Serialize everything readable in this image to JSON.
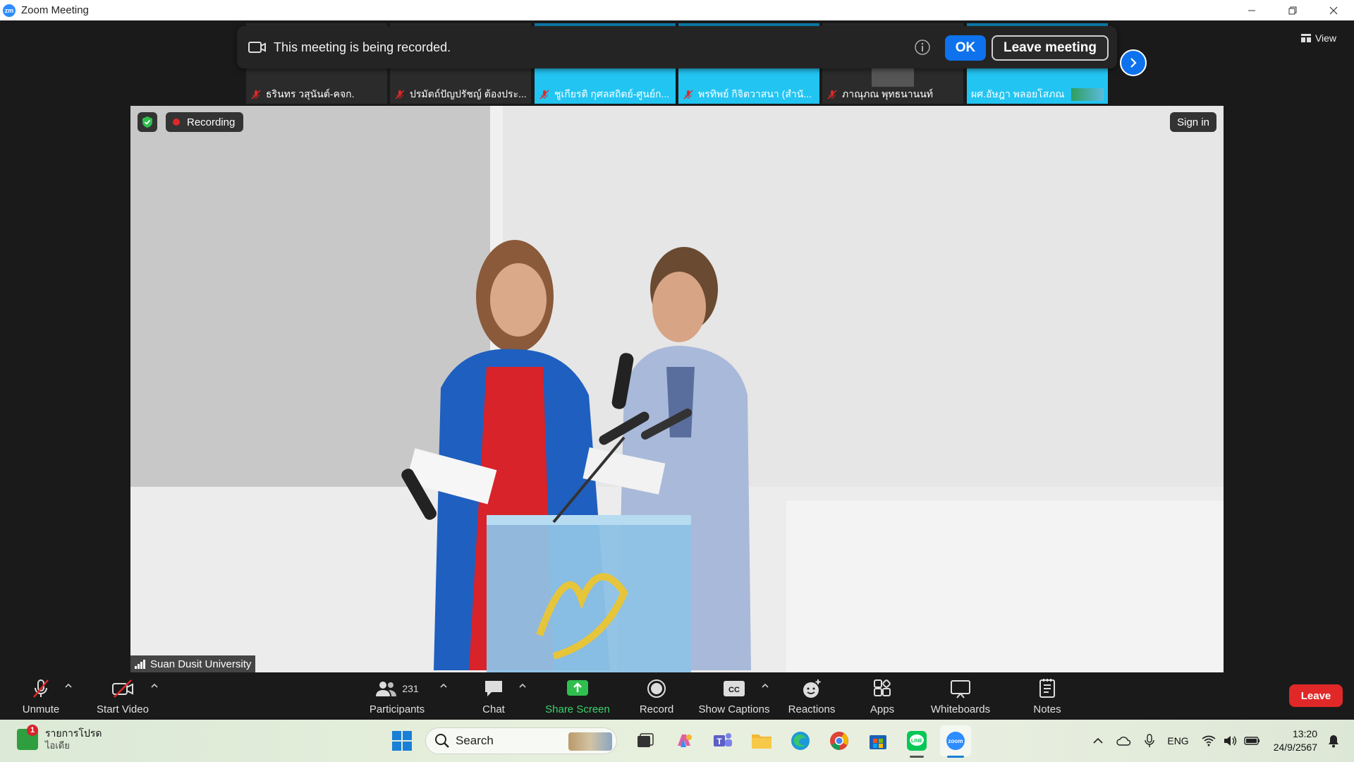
{
  "window": {
    "title": "Zoom Meeting",
    "app_icon": "zm"
  },
  "banner": {
    "message": "This meeting is being recorded.",
    "ok_label": "OK",
    "leave_label": "Leave meeting"
  },
  "view_label": "View",
  "gallery": [
    {
      "name": "ธรินทร วสุนันต์-คจก.",
      "bg": "dark"
    },
    {
      "name": "ปรมัตถ์ปัญปรัชญ์ ต้องประ...",
      "bg": "dark"
    },
    {
      "name": "ชูเกียรติ กุศลสถิตย์-ศูนย์ก...",
      "bg": "blue"
    },
    {
      "name": "พรทิพย์ กิจิตวาสนา (สำนั...",
      "bg": "blue"
    },
    {
      "name": "ภาณุภณ พุทธนานนท์",
      "bg": "dark"
    },
    {
      "name": "ผศ.อัษฎา พลอยโสภณ",
      "bg": "blue"
    }
  ],
  "video": {
    "recording_label": "Recording",
    "signin_label": "Sign in",
    "speaker_name": "Suan Dusit University",
    "podium_logo": "สดุ"
  },
  "toolbar": {
    "unmute": "Unmute",
    "start_video": "Start Video",
    "participants": "Participants",
    "participants_count": "231",
    "chat": "Chat",
    "share_screen": "Share Screen",
    "record": "Record",
    "captions": "Show Captions",
    "reactions": "Reactions",
    "apps": "Apps",
    "whiteboards": "Whiteboards",
    "notes": "Notes",
    "leave": "Leave"
  },
  "taskbar": {
    "weather_title": "รายการโปรด",
    "weather_sub": "ไอเดีย",
    "weather_badge": "1",
    "search_label": "Search",
    "lang": "ENG",
    "time": "13:20",
    "date": "24/9/2567"
  },
  "colors": {
    "accent": "#0e72ed",
    "share_green": "#3bd36b",
    "leave_red": "#e02828",
    "tile_blue": "#22c4f2"
  }
}
